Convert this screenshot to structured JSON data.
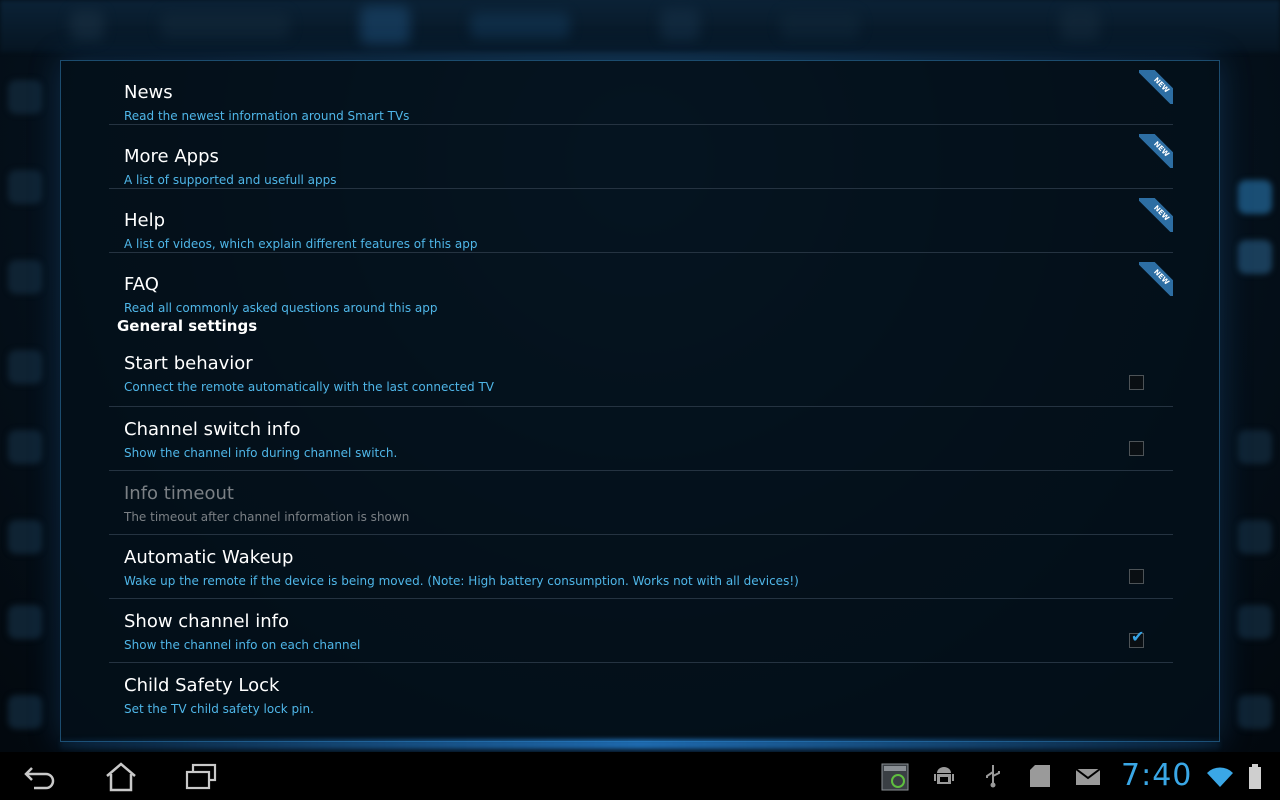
{
  "app": {
    "accent_color": "#4fb6e8",
    "title_color": "#ffffff"
  },
  "preferences_top": [
    {
      "title": "News",
      "summary": "Read the newest information around Smart TVs",
      "badge": "NEW"
    },
    {
      "title": "More Apps",
      "summary": "A list of supported and usefull apps",
      "badge": "NEW"
    },
    {
      "title": "Help",
      "summary": "A list of videos, which explain different features of this app",
      "badge": "NEW"
    },
    {
      "title": "FAQ",
      "summary": "Read all commonly asked questions around this app",
      "badge": "NEW"
    }
  ],
  "general_settings": {
    "header": "General settings",
    "items": [
      {
        "title": "Start behavior",
        "summary": "Connect the remote automatically with the last connected TV",
        "checked": false,
        "enabled": true
      },
      {
        "title": "Channel switch info",
        "summary": "Show the channel info during channel switch.",
        "checked": false,
        "enabled": true
      },
      {
        "title": "Info timeout",
        "summary": "The timeout after channel information is shown",
        "enabled": false
      },
      {
        "title": "Automatic Wakeup",
        "summary": "Wake up the remote if the device is being moved. (Note: High battery consumption. Works not with all devices!)",
        "checked": false,
        "enabled": true
      },
      {
        "title": "Show channel info",
        "summary": "Show the channel info on each channel",
        "checked": true,
        "enabled": true
      },
      {
        "title": "Child Safety Lock",
        "summary": "Set the TV child safety lock pin.",
        "enabled": true
      }
    ]
  },
  "status_bar": {
    "clock": "7:40",
    "nav_icons": [
      "back-icon",
      "home-icon",
      "recent-apps-icon"
    ],
    "tray_icons": [
      "screenshot-icon",
      "android-debug-icon",
      "usb-icon",
      "sd-card-icon",
      "email-icon",
      "wifi-icon",
      "battery-icon"
    ]
  }
}
